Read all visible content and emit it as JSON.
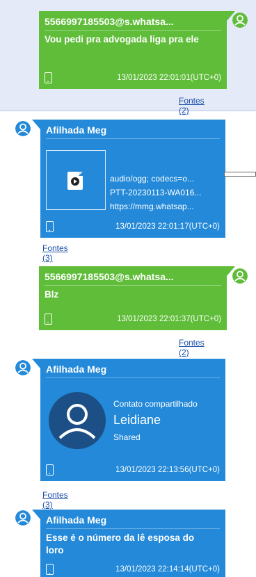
{
  "colors": {
    "incoming_green": "#5fbd39",
    "outgoing_blue": "#2389d8",
    "highlight_row": "#e4eaf7",
    "link": "#1a4fa8"
  },
  "messages": [
    {
      "sender": "5566997185503@s.whatsa...",
      "text": "Vou pedi pra advogada liga pra ele",
      "timestamp": "13/01/2023 22:01:01(UTC+0)",
      "sources": "Fontes (2)",
      "icons": [
        "person-icon",
        "phone-icon"
      ]
    },
    {
      "sender": "Afilhada Meg",
      "attachment": {
        "mime": "audio/ogg; codecs=o...",
        "filename": "PTT-20230113-WA016...",
        "url": "https://mmg.whatsap..."
      },
      "timestamp": "13/01/2023 22:01:17(UTC+0)",
      "sources": "Fontes (3)",
      "icons": [
        "person-icon",
        "audio-file-icon",
        "phone-icon"
      ]
    },
    {
      "sender": "5566997185503@s.whatsa...",
      "text": "Blz",
      "timestamp": "13/01/2023 22:01:37(UTC+0)",
      "sources": "Fontes (2)",
      "icons": [
        "person-icon",
        "phone-icon"
      ]
    },
    {
      "sender": "Afilhada Meg",
      "contact": {
        "heading": "Contato compartilhado",
        "name": "Leidiane",
        "status": "Shared"
      },
      "timestamp": "13/01/2023 22:13:56(UTC+0)",
      "sources": "Fontes (3)",
      "icons": [
        "person-icon",
        "contact-avatar-icon",
        "phone-icon"
      ]
    },
    {
      "sender": "Afilhada Meg",
      "text": "Esse é o número da lê esposa do loro",
      "timestamp": "13/01/2023 22:14:14(UTC+0)",
      "icons": [
        "person-icon",
        "phone-icon"
      ]
    }
  ]
}
